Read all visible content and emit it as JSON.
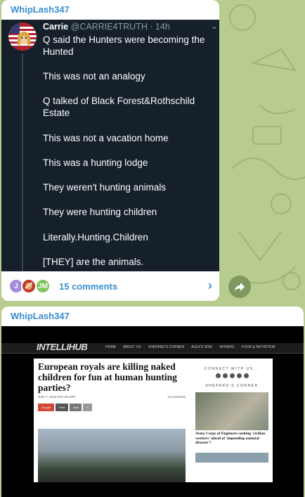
{
  "channel": {
    "sender_name": "WhipLash347"
  },
  "post1": {
    "tweet": {
      "author_name": "Carrie",
      "author_handle": "@CARRIE4TRUTH",
      "time": "· 14h",
      "lines": [
        "Q said the Hunters were becoming the Hunted",
        "This was not an analogy",
        "Q talked of Black Forest&Rothschild Estate",
        "This was not a vacation home",
        "This was a hunting lodge",
        "They weren't hunting animals",
        "They were hunting children",
        "Literally.Hunting.Children",
        "[THEY] are the animals."
      ]
    },
    "comments": {
      "label": "15 comments",
      "avatars": [
        "J",
        "",
        "JM"
      ]
    }
  },
  "post2": {
    "article": {
      "site_logo": "INTELLIHUB",
      "nav": [
        "HOME",
        "ABOUT US",
        "SHEPARD'S CORNER",
        "ALEX'S SIDE",
        "AFFAIRS",
        "FOOD & NUTRITION"
      ],
      "headline": "European royals are killing naked children for fun at human hunting parties?",
      "byline": "June 7, 2015 8:42 am EDT",
      "comments_count": "3 Comments",
      "share_buttons": [
        "Google",
        "Print",
        "Mail",
        "+"
      ],
      "sidebar_heading": "CONNECT WITH US...",
      "sidebar_section": "SHEPARD'S CORNER",
      "sidebar_caption": "Army Corps of Engineers seeking 'civilian workers' ahead of 'impending national disaster'?"
    }
  },
  "colors": {
    "accent": "#3a8ed0",
    "tweet_bg": "#15202b",
    "chat_bg": "#b9cc8f"
  }
}
